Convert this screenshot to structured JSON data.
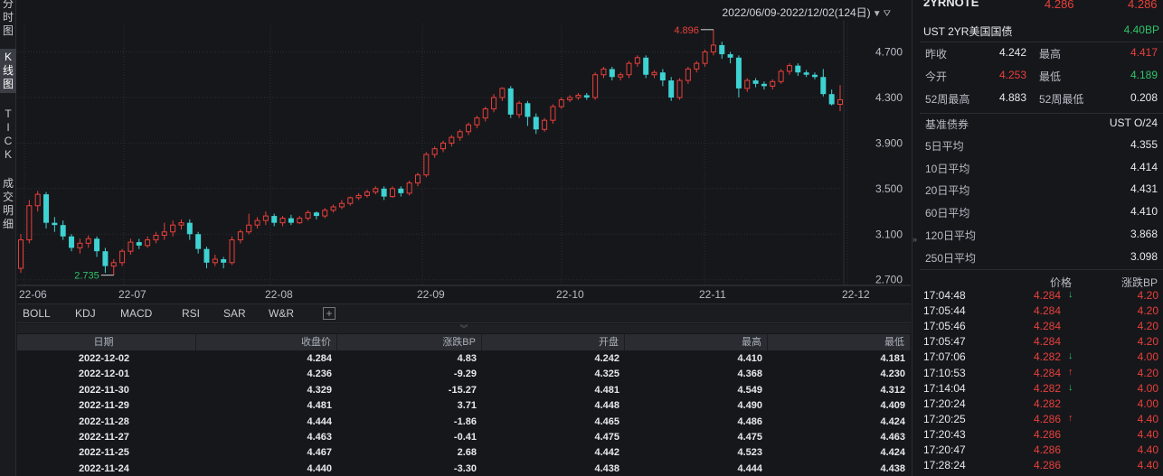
{
  "left_tabs": [
    {
      "label": "分时图",
      "chars": [
        "分",
        "时",
        "图"
      ],
      "active": false
    },
    {
      "label": "K线图",
      "chars": [
        "K",
        "线",
        "图"
      ],
      "active": true
    },
    {
      "label": "TICK",
      "chars": [
        "T",
        "I",
        "C",
        "K"
      ],
      "active": false
    },
    {
      "label": "成交明细",
      "chars": [
        "成",
        "交",
        "明",
        "细"
      ],
      "active": false
    }
  ],
  "header": {
    "date_range": "2022/06/09-2022/12/02(124日)"
  },
  "chart_data": {
    "type": "candlestick",
    "x_labels": [
      "22-06",
      "22-07",
      "22-08",
      "22-09",
      "22-10",
      "22-11",
      "22-12"
    ],
    "y_ticks": [
      "4.700",
      "4.300",
      "3.900",
      "3.500",
      "3.100",
      "2.700"
    ],
    "ylim": [
      2.65,
      4.95
    ],
    "max_label": "4.896",
    "min_label": "2.735",
    "up_color": "#e8403a",
    "down_color": "#3ed2d2",
    "candles": [
      [
        2.8,
        3.05,
        2.76,
        3.1
      ],
      [
        3.05,
        3.35,
        3.02,
        3.4
      ],
      [
        3.35,
        3.45,
        3.3,
        3.48
      ],
      [
        3.45,
        3.2,
        3.15,
        3.47
      ],
      [
        3.2,
        3.18,
        3.12,
        3.25
      ],
      [
        3.18,
        3.08,
        3.05,
        3.22
      ],
      [
        3.08,
        2.98,
        2.95,
        3.1
      ],
      [
        2.98,
        3.02,
        2.93,
        3.06
      ],
      [
        3.02,
        3.06,
        2.98,
        3.09
      ],
      [
        3.06,
        2.95,
        2.9,
        3.08
      ],
      [
        2.95,
        2.82,
        2.76,
        2.98
      ],
      [
        2.82,
        2.85,
        2.74,
        2.88
      ],
      [
        2.85,
        2.95,
        2.82,
        2.97
      ],
      [
        2.95,
        3.03,
        2.92,
        3.06
      ],
      [
        3.03,
        3.0,
        2.97,
        3.06
      ],
      [
        3.0,
        3.05,
        2.98,
        3.08
      ],
      [
        3.05,
        3.09,
        3.02,
        3.12
      ],
      [
        3.09,
        3.12,
        3.05,
        3.2
      ],
      [
        3.12,
        3.18,
        3.08,
        3.22
      ],
      [
        3.18,
        3.2,
        3.14,
        3.23
      ],
      [
        3.2,
        3.1,
        3.05,
        3.23
      ],
      [
        3.1,
        2.97,
        2.93,
        3.12
      ],
      [
        2.97,
        2.85,
        2.8,
        2.99
      ],
      [
        2.85,
        2.88,
        2.82,
        2.92
      ],
      [
        2.88,
        2.85,
        2.8,
        2.9
      ],
      [
        2.85,
        3.05,
        2.83,
        3.08
      ],
      [
        3.05,
        3.12,
        3.02,
        3.14
      ],
      [
        3.12,
        3.18,
        3.1,
        3.28
      ],
      [
        3.18,
        3.22,
        3.15,
        3.25
      ],
      [
        3.22,
        3.26,
        3.18,
        3.3
      ],
      [
        3.26,
        3.2,
        3.17,
        3.28
      ],
      [
        3.2,
        3.24,
        3.17,
        3.26
      ],
      [
        3.24,
        3.2,
        3.18,
        3.27
      ],
      [
        3.2,
        3.24,
        3.19,
        3.26
      ],
      [
        3.24,
        3.29,
        3.22,
        3.31
      ],
      [
        3.29,
        3.26,
        3.23,
        3.3
      ],
      [
        3.26,
        3.31,
        3.24,
        3.33
      ],
      [
        3.31,
        3.34,
        3.29,
        3.36
      ],
      [
        3.34,
        3.37,
        3.32,
        3.4
      ],
      [
        3.37,
        3.42,
        3.35,
        3.43
      ],
      [
        3.42,
        3.44,
        3.4,
        3.46
      ],
      [
        3.44,
        3.47,
        3.42,
        3.49
      ],
      [
        3.47,
        3.5,
        3.45,
        3.52
      ],
      [
        3.5,
        3.43,
        3.4,
        3.52
      ],
      [
        3.43,
        3.5,
        3.42,
        3.52
      ],
      [
        3.5,
        3.46,
        3.43,
        3.52
      ],
      [
        3.46,
        3.55,
        3.44,
        3.57
      ],
      [
        3.55,
        3.62,
        3.52,
        3.64
      ],
      [
        3.62,
        3.8,
        3.6,
        3.82
      ],
      [
        3.8,
        3.85,
        3.77,
        3.87
      ],
      [
        3.85,
        3.9,
        3.82,
        3.92
      ],
      [
        3.9,
        3.95,
        3.87,
        3.97
      ],
      [
        3.95,
        4.0,
        3.92,
        4.02
      ],
      [
        4.0,
        4.06,
        3.97,
        4.08
      ],
      [
        4.06,
        4.12,
        4.03,
        4.14
      ],
      [
        4.12,
        4.2,
        4.09,
        4.22
      ],
      [
        4.2,
        4.3,
        4.17,
        4.33
      ],
      [
        4.3,
        4.38,
        4.27,
        4.39
      ],
      [
        4.38,
        4.15,
        4.12,
        4.4
      ],
      [
        4.15,
        4.25,
        4.12,
        4.27
      ],
      [
        4.25,
        4.13,
        4.05,
        4.27
      ],
      [
        4.13,
        4.02,
        3.98,
        4.16
      ],
      [
        4.02,
        4.1,
        4.0,
        4.12
      ],
      [
        4.1,
        4.22,
        4.07,
        4.24
      ],
      [
        4.22,
        4.28,
        4.2,
        4.3
      ],
      [
        4.28,
        4.3,
        4.26,
        4.32
      ],
      [
        4.3,
        4.32,
        4.28,
        4.34
      ],
      [
        4.32,
        4.3,
        4.28,
        4.34
      ],
      [
        4.3,
        4.5,
        4.28,
        4.52
      ],
      [
        4.5,
        4.55,
        4.47,
        4.57
      ],
      [
        4.55,
        4.48,
        4.45,
        4.57
      ],
      [
        4.48,
        4.5,
        4.45,
        4.52
      ],
      [
        4.5,
        4.6,
        4.47,
        4.62
      ],
      [
        4.6,
        4.65,
        4.57,
        4.67
      ],
      [
        4.65,
        4.5,
        4.47,
        4.67
      ],
      [
        4.5,
        4.52,
        4.47,
        4.54
      ],
      [
        4.52,
        4.45,
        4.4,
        4.55
      ],
      [
        4.45,
        4.3,
        4.27,
        4.48
      ],
      [
        4.3,
        4.45,
        4.28,
        4.47
      ],
      [
        4.45,
        4.55,
        4.42,
        4.57
      ],
      [
        4.55,
        4.6,
        4.52,
        4.62
      ],
      [
        4.6,
        4.7,
        4.57,
        4.72
      ],
      [
        4.7,
        4.76,
        4.67,
        4.896
      ],
      [
        4.76,
        4.68,
        4.64,
        4.79
      ],
      [
        4.68,
        4.65,
        4.6,
        4.7
      ],
      [
        4.65,
        4.38,
        4.3,
        4.67
      ],
      [
        4.38,
        4.45,
        4.35,
        4.47
      ],
      [
        4.45,
        4.42,
        4.39,
        4.47
      ],
      [
        4.42,
        4.4,
        4.37,
        4.44
      ],
      [
        4.4,
        4.44,
        4.37,
        4.46
      ],
      [
        4.44,
        4.53,
        4.42,
        4.55
      ],
      [
        4.53,
        4.58,
        4.5,
        4.6
      ],
      [
        4.58,
        4.52,
        4.49,
        4.6
      ],
      [
        4.52,
        4.5,
        4.48,
        4.54
      ],
      [
        4.5,
        4.48,
        4.46,
        4.52
      ],
      [
        4.48,
        4.33,
        4.31,
        4.55
      ],
      [
        4.33,
        4.24,
        4.23,
        4.37
      ],
      [
        4.24,
        4.28,
        4.18,
        4.41
      ]
    ]
  },
  "indicator_tabs": [
    "BOLL",
    "KDJ",
    "MACD",
    "RSI",
    "SAR",
    "W&R"
  ],
  "table": {
    "headers": [
      "日期",
      "收盘价",
      "涨跌BP",
      "开盘",
      "最高",
      "最低"
    ],
    "rows": [
      [
        "2022-12-02",
        "4.284",
        "4.83",
        "4.242",
        "4.410",
        "4.181"
      ],
      [
        "2022-12-01",
        "4.236",
        "-9.29",
        "4.325",
        "4.368",
        "4.230"
      ],
      [
        "2022-11-30",
        "4.329",
        "-15.27",
        "4.481",
        "4.549",
        "4.312"
      ],
      [
        "2022-11-29",
        "4.481",
        "3.71",
        "4.448",
        "4.490",
        "4.409"
      ],
      [
        "2022-11-28",
        "4.444",
        "-1.86",
        "4.465",
        "4.486",
        "4.424"
      ],
      [
        "2022-11-27",
        "4.463",
        "-0.41",
        "4.475",
        "4.475",
        "4.463"
      ],
      [
        "2022-11-25",
        "4.467",
        "2.68",
        "4.442",
        "4.523",
        "4.424"
      ],
      [
        "2022-11-24",
        "4.440",
        "-3.30",
        "4.438",
        "4.444",
        "4.438"
      ]
    ]
  },
  "quote": {
    "code": "2YRNOTE",
    "price": "4.286",
    "price2": "4.286",
    "name": "UST 2YR美国国债",
    "change": "4.40BP",
    "stats": [
      {
        "l1": "昨收",
        "v1": "4.242",
        "c1": "white",
        "l2": "最高",
        "v2": "4.417",
        "c2": "red"
      },
      {
        "l1": "今开",
        "v1": "4.253",
        "c1": "red",
        "l2": "最低",
        "v2": "4.189",
        "c2": "green"
      },
      {
        "l1": "52周最高",
        "v1": "4.883",
        "c1": "white",
        "l2": "52周最低",
        "v2": "0.208",
        "c2": "white"
      }
    ],
    "bench_label": "基准债券",
    "bench_value": "UST O/24",
    "averages": [
      {
        "label": "5日平均",
        "value": "4.355"
      },
      {
        "label": "10日平均",
        "value": "4.414"
      },
      {
        "label": "20日平均",
        "value": "4.431"
      },
      {
        "label": "60日平均",
        "value": "4.410"
      },
      {
        "label": "120日平均",
        "value": "3.868"
      },
      {
        "label": "250日平均",
        "value": "3.098"
      }
    ],
    "ticks_header": {
      "price": "价格",
      "bp": "涨跌BP"
    },
    "ticks": [
      {
        "time": "17:04:48",
        "price": "4.284",
        "arrow": "↓",
        "bp": "4.20"
      },
      {
        "time": "17:05:44",
        "price": "4.284",
        "arrow": "",
        "bp": "4.20"
      },
      {
        "time": "17:05:46",
        "price": "4.284",
        "arrow": "",
        "bp": "4.20"
      },
      {
        "time": "17:05:47",
        "price": "4.284",
        "arrow": "",
        "bp": "4.20"
      },
      {
        "time": "17:07:06",
        "price": "4.282",
        "arrow": "↓",
        "bp": "4.00"
      },
      {
        "time": "17:10:53",
        "price": "4.284",
        "arrow": "↑",
        "bp": "4.20"
      },
      {
        "time": "17:14:04",
        "price": "4.282",
        "arrow": "↓",
        "bp": "4.00"
      },
      {
        "time": "17:20:24",
        "price": "4.282",
        "arrow": "",
        "bp": "4.00"
      },
      {
        "time": "17:20:25",
        "price": "4.286",
        "arrow": "↑",
        "bp": "4.40"
      },
      {
        "time": "17:20:43",
        "price": "4.286",
        "arrow": "",
        "bp": "4.40"
      },
      {
        "time": "17:20:47",
        "price": "4.286",
        "arrow": "",
        "bp": "4.40"
      },
      {
        "time": "17:28:24",
        "price": "4.286",
        "arrow": "",
        "bp": "4.40"
      }
    ]
  }
}
